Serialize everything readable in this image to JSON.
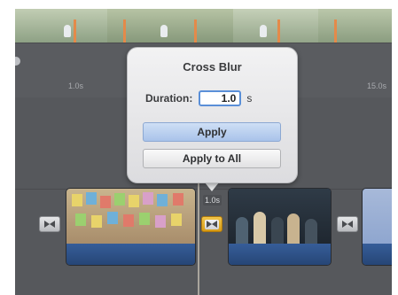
{
  "popover": {
    "title": "Cross Blur",
    "duration_label": "Duration:",
    "duration_value": "1.0",
    "duration_unit": "s",
    "apply_label": "Apply",
    "apply_all_label": "Apply to All"
  },
  "ruler": {
    "tick_left": "1.0s",
    "tick_right": "15.0s"
  },
  "timeline": {
    "transition_duration": "1.0s"
  },
  "colors": {
    "accent_selected": "#d79b15",
    "clip_band": "#2d4f86",
    "apply_button": "#a9c3ea"
  },
  "icons": {
    "transition": "bowtie-transition-icon"
  }
}
